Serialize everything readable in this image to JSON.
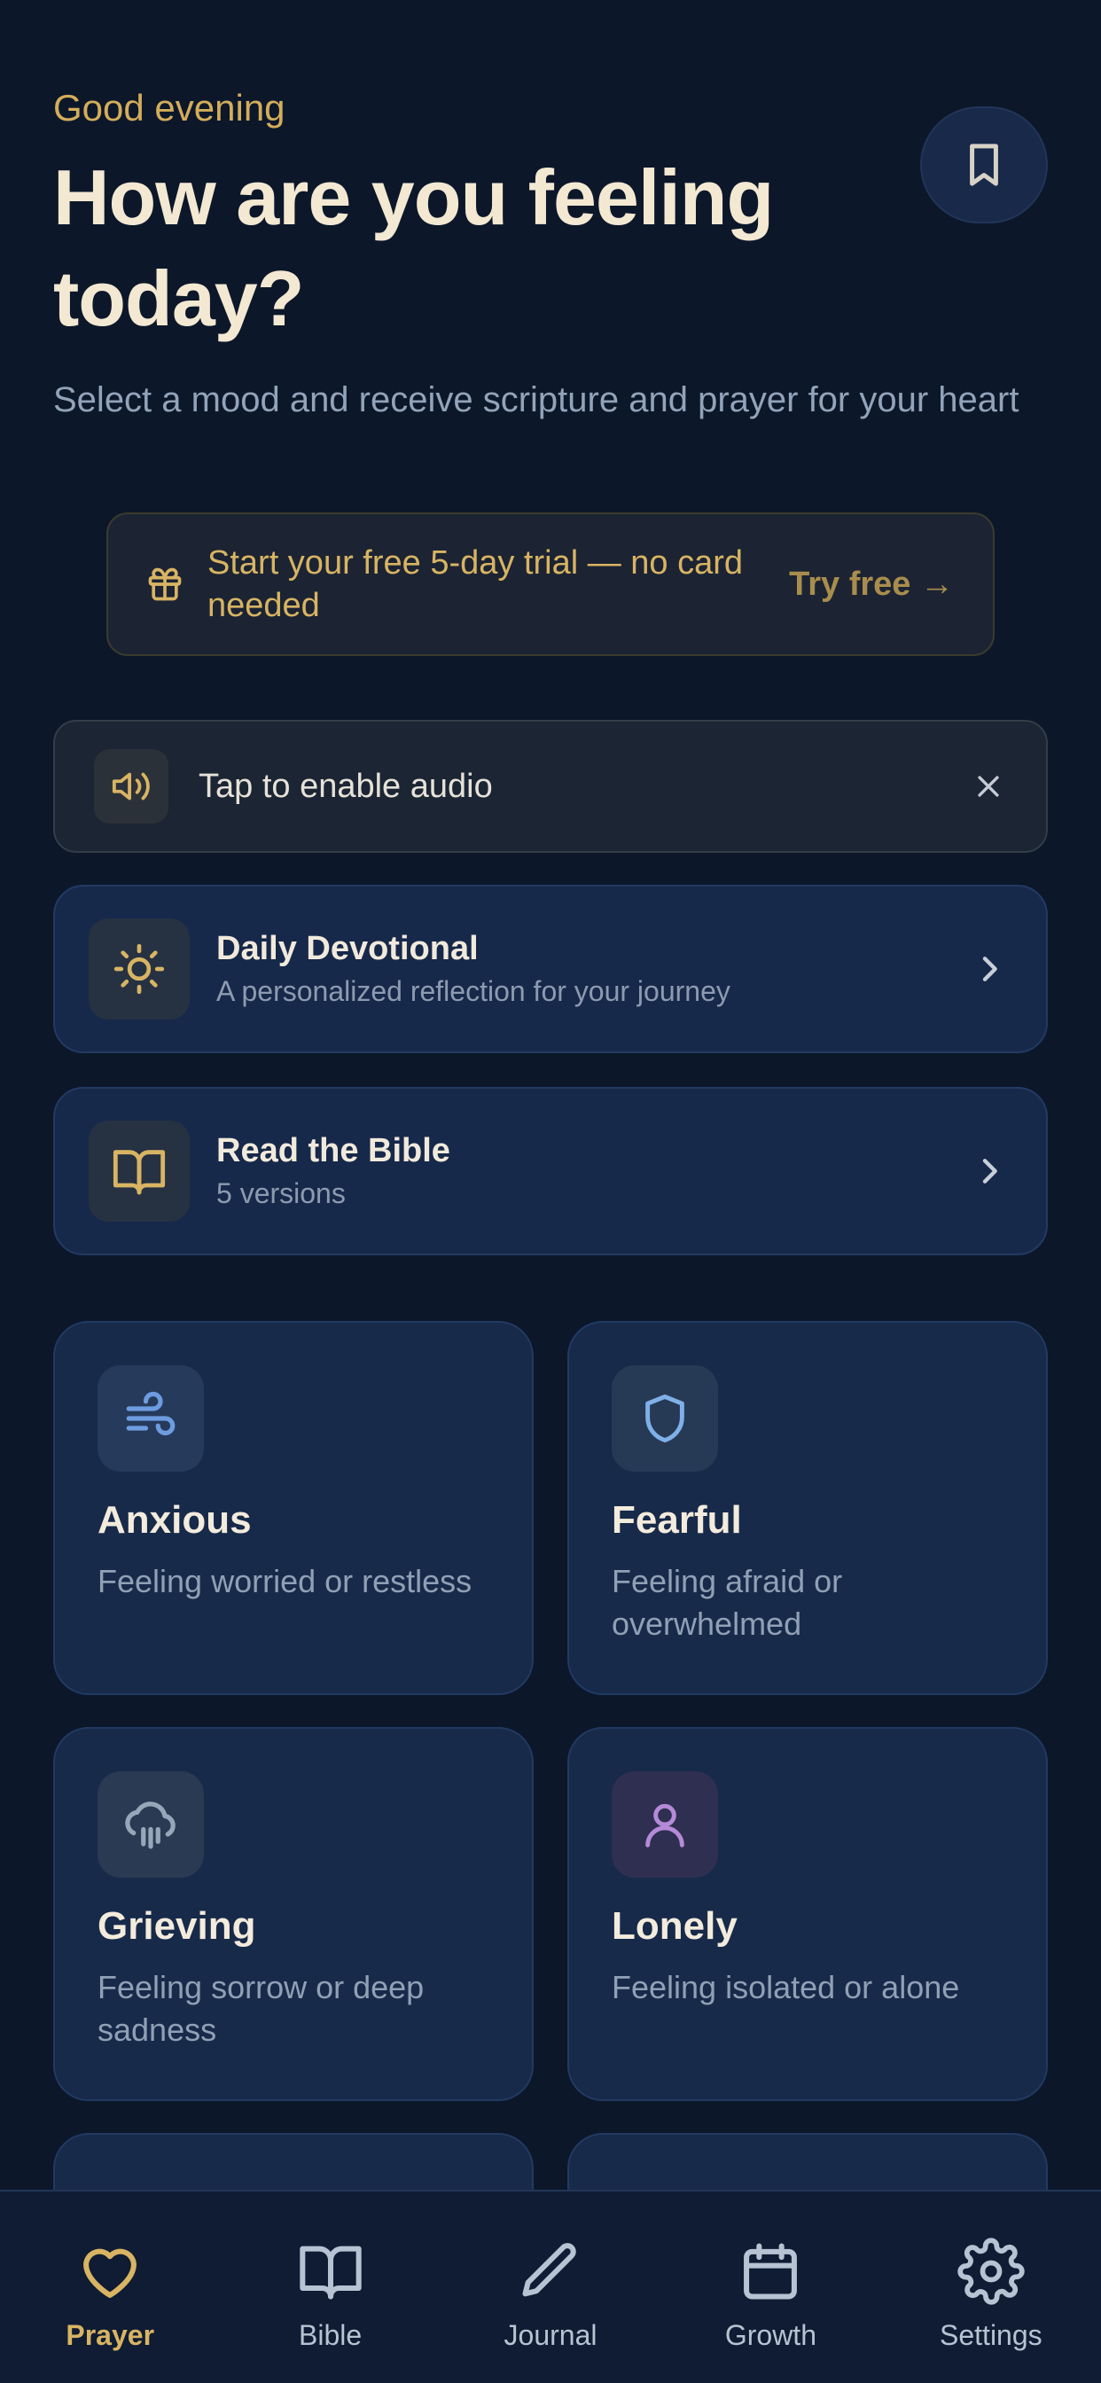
{
  "header": {
    "greeting": "Good evening",
    "title": "How are you feeling today?",
    "subtitle": "Select a mood and receive scripture and prayer for your heart",
    "bookmark_icon": "bookmark-icon"
  },
  "trial_banner": {
    "text": "Start your free 5-day trial — no card needed",
    "cta": "Try free →",
    "icon": "gift-icon"
  },
  "audio_banner": {
    "label": "Tap to enable audio",
    "icon": "speaker-icon",
    "close_icon": "close-icon"
  },
  "nav_cards": [
    {
      "title": "Daily Devotional",
      "subtitle": "A personalized reflection for your journey",
      "icon": "sun-icon"
    },
    {
      "title": "Read the Bible",
      "subtitle": "5 versions",
      "icon": "book-open-icon"
    }
  ],
  "moods": [
    {
      "title": "Anxious",
      "description": "Feeling worried or restless",
      "icon": "wind-icon",
      "color": "#6d9ce0"
    },
    {
      "title": "Fearful",
      "description": "Feeling afraid or overwhelmed",
      "icon": "shield-icon",
      "color": "#7fb0e8"
    },
    {
      "title": "Grieving",
      "description": "Feeling sorrow or deep sadness",
      "icon": "cloud-rain-icon",
      "color": "#97a7ba"
    },
    {
      "title": "Lonely",
      "description": "Feeling isolated or alone",
      "icon": "user-icon",
      "color": "#b58ad8"
    }
  ],
  "tabbar": {
    "active": "Prayer",
    "items": [
      {
        "label": "Prayer",
        "icon": "heart-icon"
      },
      {
        "label": "Bible",
        "icon": "book-open-icon"
      },
      {
        "label": "Journal",
        "icon": "pencil-icon"
      },
      {
        "label": "Growth",
        "icon": "calendar-icon"
      },
      {
        "label": "Settings",
        "icon": "gear-icon"
      }
    ]
  },
  "colors": {
    "background": "#0c172a",
    "card": "#172a4a",
    "accent_gold": "#d4ad5a",
    "title_cream": "#f3e8d2",
    "muted_text": "#90a0b5"
  }
}
